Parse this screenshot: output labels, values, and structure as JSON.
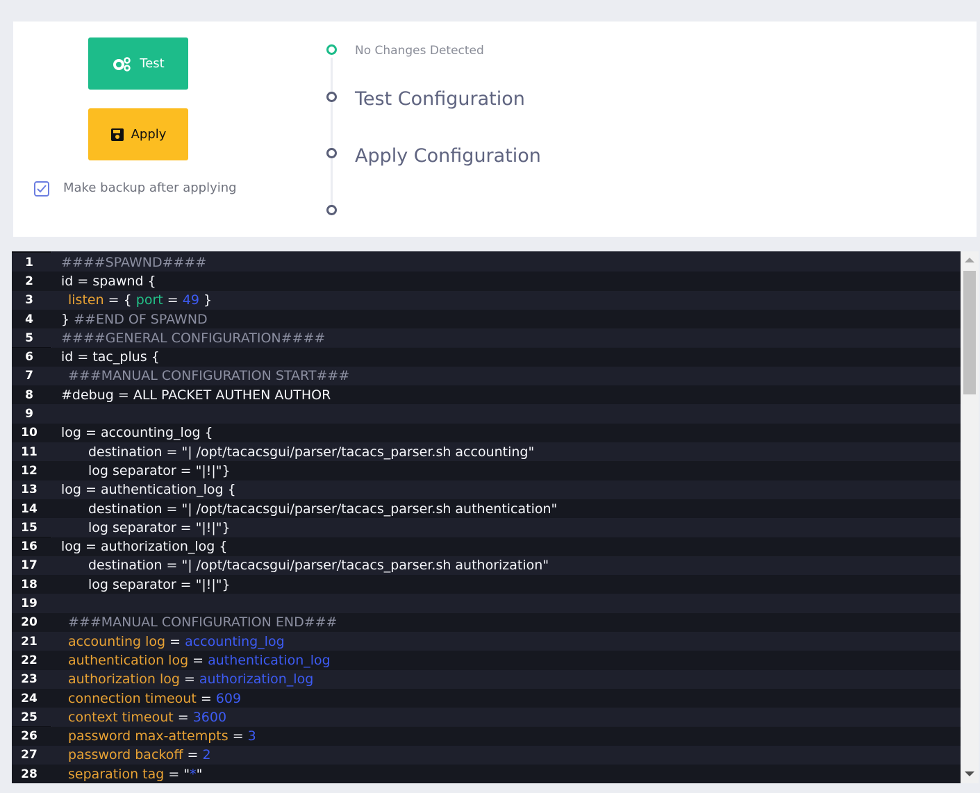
{
  "actions": {
    "test_label": "Test",
    "apply_label": "Apply",
    "backup_label": "Make backup after applying",
    "backup_checked": true
  },
  "timeline": {
    "status": "No Changes Detected",
    "step1": "Test Configuration",
    "step2": "Apply Configuration"
  },
  "editor": {
    "lines": [
      {
        "n": "1",
        "parts": [
          [
            "c",
            "####SPAWND####"
          ]
        ],
        "indent": 0
      },
      {
        "n": "2",
        "parts": [
          [
            "w",
            "id = spawnd {"
          ]
        ],
        "indent": 0
      },
      {
        "n": "3",
        "parts": [
          [
            "k",
            "listen"
          ],
          [
            "w",
            " = { "
          ],
          [
            "g",
            "port"
          ],
          [
            "w",
            " = "
          ],
          [
            "n",
            "49"
          ],
          [
            "w",
            " }"
          ]
        ],
        "indent": 1
      },
      {
        "n": "4",
        "parts": [
          [
            "w",
            "} "
          ],
          [
            "c",
            "##END OF SPAWND"
          ]
        ],
        "indent": 0
      },
      {
        "n": "5",
        "parts": [
          [
            "c",
            "####GENERAL CONFIGURATION####"
          ]
        ],
        "indent": 0
      },
      {
        "n": "6",
        "parts": [
          [
            "w",
            "id = tac_plus {"
          ]
        ],
        "indent": 0
      },
      {
        "n": "7",
        "parts": [
          [
            "c",
            "###MANUAL CONFIGURATION START###"
          ]
        ],
        "indent": 1
      },
      {
        "n": "8",
        "parts": [
          [
            "w",
            "#debug = ALL PACKET AUTHEN AUTHOR"
          ]
        ],
        "indent": 0
      },
      {
        "n": "9",
        "parts": [],
        "indent": 0
      },
      {
        "n": "10",
        "parts": [
          [
            "w",
            "log = accounting_log {"
          ]
        ],
        "indent": 0
      },
      {
        "n": "11",
        "parts": [
          [
            "w",
            "destination = \"| /opt/tacacsgui/parser/tacacs_parser.sh accounting\""
          ]
        ],
        "indent": 4
      },
      {
        "n": "12",
        "parts": [
          [
            "w",
            "log separator = \"|!|\"}"
          ]
        ],
        "indent": 4
      },
      {
        "n": "13",
        "parts": [
          [
            "w",
            "log = authentication_log {"
          ]
        ],
        "indent": 0
      },
      {
        "n": "14",
        "parts": [
          [
            "w",
            "destination = \"| /opt/tacacsgui/parser/tacacs_parser.sh authentication\""
          ]
        ],
        "indent": 4
      },
      {
        "n": "15",
        "parts": [
          [
            "w",
            "log separator = \"|!|\"}"
          ]
        ],
        "indent": 4
      },
      {
        "n": "16",
        "parts": [
          [
            "w",
            "log = authorization_log {"
          ]
        ],
        "indent": 0
      },
      {
        "n": "17",
        "parts": [
          [
            "w",
            "destination = \"| /opt/tacacsgui/parser/tacacs_parser.sh authorization\""
          ]
        ],
        "indent": 4
      },
      {
        "n": "18",
        "parts": [
          [
            "w",
            "log separator = \"|!|\"}"
          ]
        ],
        "indent": 4
      },
      {
        "n": "19",
        "parts": [],
        "indent": 0
      },
      {
        "n": "20",
        "parts": [
          [
            "c",
            "###MANUAL CONFIGURATION END###"
          ]
        ],
        "indent": 1
      },
      {
        "n": "21",
        "parts": [
          [
            "k",
            "accounting log"
          ],
          [
            "w",
            " = "
          ],
          [
            "n",
            "accounting_log"
          ]
        ],
        "indent": 1
      },
      {
        "n": "22",
        "parts": [
          [
            "k",
            "authentication log"
          ],
          [
            "w",
            " = "
          ],
          [
            "n",
            "authentication_log"
          ]
        ],
        "indent": 1
      },
      {
        "n": "23",
        "parts": [
          [
            "k",
            "authorization log"
          ],
          [
            "w",
            " = "
          ],
          [
            "n",
            "authorization_log"
          ]
        ],
        "indent": 1
      },
      {
        "n": "24",
        "parts": [
          [
            "k",
            "connection timeout"
          ],
          [
            "w",
            " = "
          ],
          [
            "n",
            "609"
          ]
        ],
        "indent": 1
      },
      {
        "n": "25",
        "parts": [
          [
            "k",
            "context timeout"
          ],
          [
            "w",
            " = "
          ],
          [
            "n",
            "3600"
          ]
        ],
        "indent": 1
      },
      {
        "n": "26",
        "parts": [
          [
            "k",
            "password max-attempts"
          ],
          [
            "w",
            " = "
          ],
          [
            "n",
            "3"
          ]
        ],
        "indent": 1
      },
      {
        "n": "27",
        "parts": [
          [
            "k",
            "password backoff"
          ],
          [
            "w",
            " = "
          ],
          [
            "n",
            "2"
          ]
        ],
        "indent": 1
      },
      {
        "n": "28",
        "parts": [
          [
            "k",
            "separation tag"
          ],
          [
            "w",
            " = \""
          ],
          [
            "n",
            "*"
          ],
          [
            "w",
            "\""
          ]
        ],
        "indent": 1
      }
    ]
  }
}
